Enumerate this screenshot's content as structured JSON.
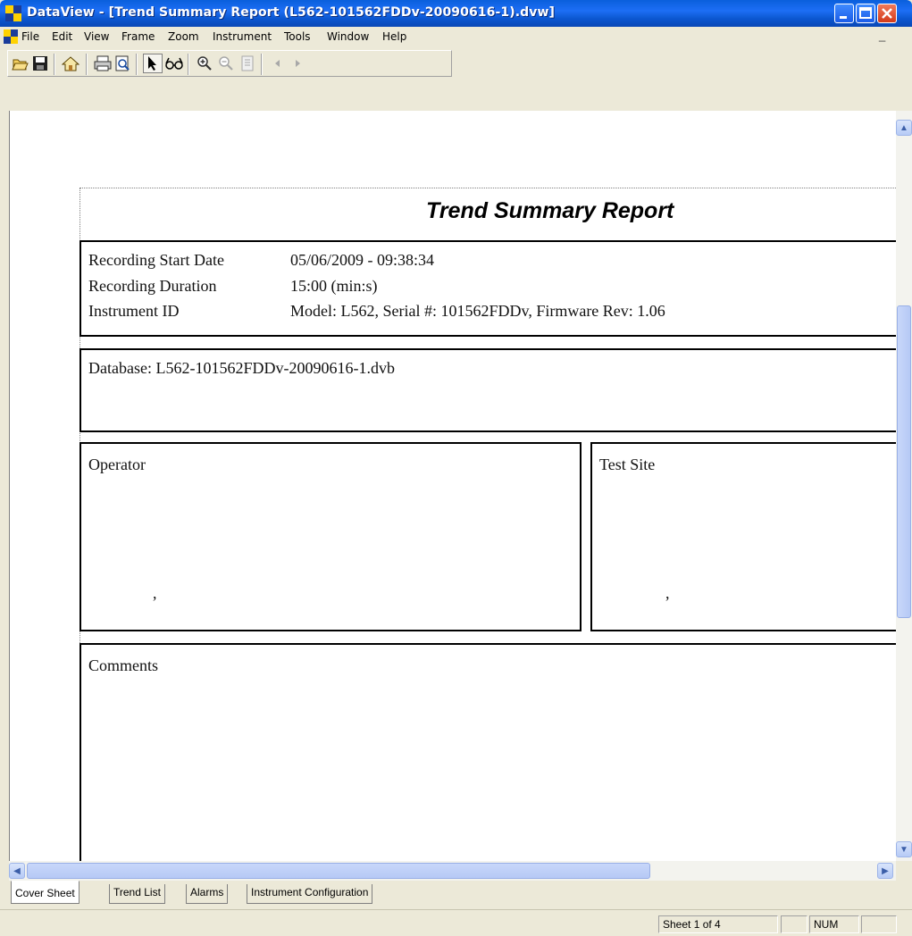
{
  "window": {
    "title": "DataView - [Trend Summary Report (L562-101562FDDv-20090616-1).dvw]",
    "accent": "#0a5fdc"
  },
  "menu": {
    "items": [
      "File",
      "Edit",
      "View",
      "Frame",
      "Zoom",
      "Instrument",
      "Tools",
      "Window",
      "Help"
    ]
  },
  "toolbar": {
    "icons": [
      "open-icon",
      "save-icon",
      "home-icon",
      "print-icon",
      "print-preview-icon",
      "pointer-icon",
      "glasses-icon",
      "zoom-in-icon",
      "zoom-out-icon",
      "fit-page-icon",
      "previous-icon",
      "next-icon"
    ]
  },
  "report": {
    "title": "Trend Summary Report",
    "fields": [
      {
        "label": "Recording Start Date",
        "value": "05/06/2009 - 09:38:34"
      },
      {
        "label": "Recording Duration",
        "value": "15:00 (min:s)"
      },
      {
        "label": "Instrument ID",
        "value": "Model: L562, Serial #: 101562FDDv, Firmware Rev: 1.06"
      }
    ],
    "database": "Database: L562-101562FDDv-20090616-1.dvb",
    "operator_label": "Operator",
    "operator_comma": ",",
    "test_site_label": "Test Site",
    "test_site_comma": ",",
    "comments_label": "Comments"
  },
  "tabs": [
    "Cover Sheet",
    "Trend List",
    "Alarms",
    "Instrument Configuration"
  ],
  "active_tab": "Cover Sheet",
  "status": {
    "sheet": "Sheet 1 of 4",
    "num": "NUM"
  }
}
